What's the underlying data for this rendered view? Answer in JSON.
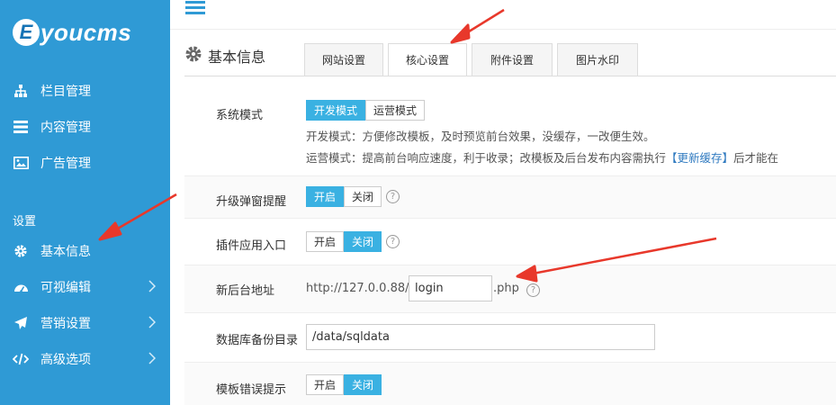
{
  "brand": {
    "logo_letter": "E",
    "logo_text": "youcms"
  },
  "sidebar": {
    "items": [
      {
        "label": "栏目管理",
        "icon": "sitemap-icon"
      },
      {
        "label": "内容管理",
        "icon": "list-icon"
      },
      {
        "label": "广告管理",
        "icon": "image-icon"
      }
    ],
    "section_label": "设置",
    "settings_items": [
      {
        "label": "基本信息",
        "icon": "gear-icon"
      },
      {
        "label": "可视编辑",
        "icon": "dashboard-icon"
      },
      {
        "label": "营销设置",
        "icon": "send-icon"
      },
      {
        "label": "高级选项",
        "icon": "code-icon"
      }
    ]
  },
  "page": {
    "title": "基本信息"
  },
  "tabs": [
    "网站设置",
    "核心设置",
    "附件设置",
    "图片水印"
  ],
  "active_tab": "核心设置",
  "form": {
    "system_mode": {
      "label": "系统模式",
      "options": [
        "开发模式",
        "运营模式"
      ],
      "selected": "开发模式",
      "desc1": "开发模式：方便修改模板，及时预览前台效果，没缓存，一改便生效。",
      "desc2_prefix": "运营模式：提高前台响应速度，利于收录；改模板及后台发布内容需执行",
      "desc2_link": "【更新缓存】",
      "desc2_suffix": "后才能在"
    },
    "upgrade_popup": {
      "label": "升级弹窗提醒",
      "on": "开启",
      "off": "关闭",
      "selected": "开启",
      "help": "?"
    },
    "plugin_entry": {
      "label": "插件应用入口",
      "on": "开启",
      "off": "关闭",
      "selected": "关闭",
      "help": "?"
    },
    "admin_url": {
      "label": "新后台地址",
      "prefix": "http://127.0.0.88/",
      "value": "login",
      "suffix": ".php",
      "help": "?"
    },
    "backup_dir": {
      "label": "数据库备份目录",
      "value": "/data/sqldata"
    },
    "template_error": {
      "label": "模板错误提示",
      "on": "开启",
      "off": "关闭",
      "selected": "关闭"
    }
  },
  "colors": {
    "sidebar": "#2f9ad5",
    "toggle_active": "#3ab1e2",
    "arrow": "#e8382b"
  }
}
